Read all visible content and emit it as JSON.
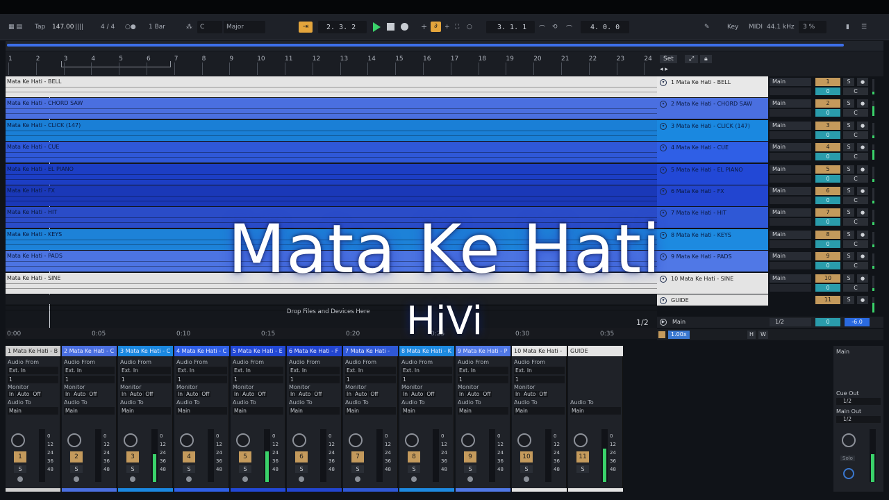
{
  "transport": {
    "tap": "Tap",
    "bpm": "147.00",
    "meter": "4 / 4",
    "quant": "1 Bar",
    "key": "C",
    "scale": "Major",
    "pos": "2.  3.  2",
    "loop_start": "3.  1.  1",
    "loop_len": "4.  0.  0",
    "key_lbl": "Key",
    "midi_lbl": "MIDI",
    "rate": "44.1 kHz",
    "cpu": "3 %"
  },
  "ruler": {
    "ticks": [
      "1",
      "2",
      "3",
      "4",
      "5",
      "6",
      "7",
      "8",
      "9",
      "10",
      "11",
      "12",
      "13",
      "14",
      "15",
      "16",
      "17",
      "18",
      "19",
      "20",
      "21",
      "22",
      "23",
      "24"
    ],
    "set": "Set"
  },
  "time": {
    "ticks": [
      "0:00",
      "0:05",
      "0:10",
      "0:15",
      "0:20",
      "0:25",
      "0:30",
      "0:35"
    ],
    "page": "1/2"
  },
  "tracks": [
    {
      "clip": "Mata Ke Hati - BELL",
      "head": "1 Mata Ke Hati - BELL",
      "out": "Main",
      "num": "1",
      "vol": "0",
      "bg": "#e4e4e4",
      "hbg": "#e8e8e8",
      "tc": "#222"
    },
    {
      "clip": "Mata Ke Hati - CHORD SAW",
      "head": "2 Mata Ke Hati - CHORD SAW",
      "out": "Main",
      "num": "2",
      "vol": "0",
      "bg": "#4a6fe0",
      "hbg": "#4a6fe0",
      "tc": "#0a1a40"
    },
    {
      "clip": "Mata Ke Hati - CLICK (147)",
      "head": "3 Mata Ke Hati - CLICK (147)",
      "out": "Main",
      "num": "3",
      "vol": "0",
      "bg": "#1a7fd6",
      "hbg": "#1a88e0",
      "tc": "#0a1a40"
    },
    {
      "clip": "Mata Ke Hati - CUE",
      "head": "4 Mata Ke Hati - CUE",
      "out": "Main",
      "num": "4",
      "vol": "0",
      "bg": "#2f58d8",
      "hbg": "#2f5fe6",
      "tc": "#0a1a40"
    },
    {
      "clip": "Mata Ke Hati - EL PIANO",
      "head": "5 Mata Ke Hati - EL PIANO",
      "out": "Main",
      "num": "5",
      "vol": "0",
      "bg": "#1c3ec4",
      "hbg": "#2248d6",
      "tc": "#0a1a40"
    },
    {
      "clip": "Mata Ke Hati - FX",
      "head": "6 Mata Ke Hati - FX",
      "out": "Main",
      "num": "6",
      "vol": "0",
      "bg": "#1a38b8",
      "hbg": "#2245d0",
      "tc": "#0a1a40"
    },
    {
      "clip": "Mata Ke Hati - HIT",
      "head": "7 Mata Ke Hati - HIT",
      "out": "Main",
      "num": "7",
      "vol": "0",
      "bg": "#2a4cc8",
      "hbg": "#2f58d6",
      "tc": "#0a1a40"
    },
    {
      "clip": "Mata Ke Hati - KEYS",
      "head": "8 Mata Ke Hati - KEYS",
      "out": "Main",
      "num": "8",
      "vol": "0",
      "bg": "#1d82d8",
      "hbg": "#1d8ae0",
      "tc": "#0a1a40"
    },
    {
      "clip": "Mata Ke Hati - PADS",
      "head": "9 Mata Ke Hati - PADS",
      "out": "Main",
      "num": "9",
      "vol": "0",
      "bg": "#4c74e2",
      "hbg": "#5078e6",
      "tc": "#0a1a40"
    },
    {
      "clip": "Mata Ke Hati - SINE",
      "head": "10 Mata Ke Hati - SINE",
      "out": "Main",
      "num": "10",
      "vol": "0",
      "bg": "#e2e2e2",
      "hbg": "#e4e4e4",
      "tc": "#222"
    },
    {
      "clip": "",
      "head": "GUIDE",
      "out": "",
      "num": "11",
      "vol": "",
      "bg": "#1a1d22",
      "hbg": "#e4e4e4",
      "tc": "#222"
    }
  ],
  "drop_text": "Drop Files and Devices Here",
  "main_row": {
    "label": "Main",
    "route": "1/2",
    "vol": "0",
    "pan": "-6.0"
  },
  "zoom": "1.00x",
  "hw": [
    "H",
    "W"
  ],
  "strips": [
    {
      "name": "1 Mata Ke Hati - B",
      "num": "1",
      "color": "#cfcfcf",
      "hc": "#222"
    },
    {
      "name": "2 Mata Ke Hati - C",
      "num": "2",
      "color": "#4a6fe0",
      "hc": "#eef"
    },
    {
      "name": "3 Mata Ke Hati - C",
      "num": "3",
      "color": "#1a88e0",
      "hc": "#eef"
    },
    {
      "name": "4 Mata Ke Hati - C",
      "num": "4",
      "color": "#2f5fe6",
      "hc": "#eef"
    },
    {
      "name": "5 Mata Ke Hati - E",
      "num": "5",
      "color": "#2248d6",
      "hc": "#eef"
    },
    {
      "name": "6 Mata Ke Hati - F",
      "num": "6",
      "color": "#2245d0",
      "hc": "#eef"
    },
    {
      "name": "7 Mata Ke Hati -",
      "num": "7",
      "color": "#2f58d6",
      "hc": "#eef"
    },
    {
      "name": "8 Mata Ke Hati - K",
      "num": "8",
      "color": "#1d8ae0",
      "hc": "#eef"
    },
    {
      "name": "9 Mata Ke Hati - P",
      "num": "9",
      "color": "#5078e6",
      "hc": "#eef"
    },
    {
      "name": "10 Mata Ke Hati -",
      "num": "10",
      "color": "#e4e4e4",
      "hc": "#222"
    },
    {
      "name": "GUIDE",
      "num": "11",
      "color": "#e4e4e4",
      "hc": "#222"
    }
  ],
  "strip_labels": {
    "audio_from": "Audio From",
    "ext_in": "Ext. In",
    "ch": "1",
    "monitor": "Monitor",
    "in": "In",
    "auto": "Auto",
    "off": "Off",
    "audio_to": "Audio To",
    "main": "Main",
    "solo": "S",
    "scale": [
      "0",
      "12",
      "24",
      "36",
      "48"
    ]
  },
  "master": {
    "title": "Main",
    "cue_out": "Cue Out",
    "cue_val": "1/2",
    "main_out": "Main Out",
    "main_val": "1/2",
    "solo": "Solo"
  },
  "overlay": {
    "title": "Mata Ke Hati",
    "artist": "HiVi"
  }
}
